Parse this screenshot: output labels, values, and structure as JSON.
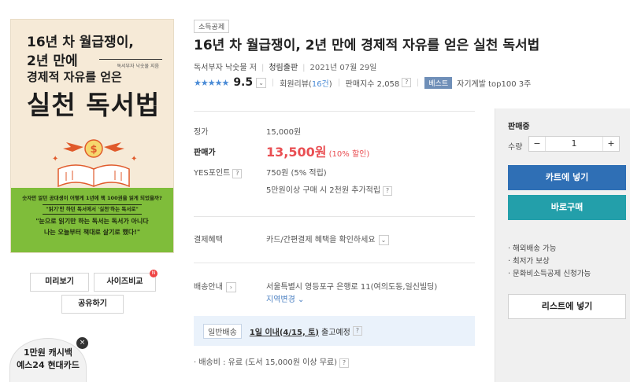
{
  "cover": {
    "line1": "16년 차 월급쟁이,",
    "line2": "2년 만에",
    "line3": "경제적 자유를 얻은",
    "line4": "실천 독서법",
    "byline": "독서부자 낙숫물 지음",
    "band_line1": "숫자만 알던 공대생이 어떻게 1년에 책 100권을 읽게 되었을까?",
    "band_line2": "\"읽기'만 하던 독서에서 '실천'하는 독서로\"",
    "band_line3": "\"눈으로 읽기만 하는 독서는 독서가 아니다",
    "band_line4": "나는 오늘부터 책대로 살기로 했다!\""
  },
  "left_buttons": {
    "preview": "미리보기",
    "size_compare": "사이즈비교",
    "share": "공유하기",
    "badge": "N"
  },
  "promo": {
    "line1": "1만원 캐시백",
    "line2": "예스24 현대카드",
    "close": "×"
  },
  "product": {
    "category_tag": "소득공제",
    "title": "16년 차 월급쟁이, 2년 만에 경제적 자유를 얻은 실천 독서법",
    "author": "독서부자 낙숫물 저",
    "publisher": "청림출판",
    "date": "2021년 07월 29일"
  },
  "rating": {
    "stars": "★★★★★",
    "score": "9.5",
    "dropdown": "⌄",
    "review_label": "회원리뷰(",
    "review_count": "16건",
    "review_close": ")",
    "sales_label": "판매지수 2,058",
    "help": "?",
    "best_tag": "베스트",
    "best_text": "자기계발 top100 3주"
  },
  "price": {
    "list_label": "정가",
    "list_value": "15,000원",
    "sale_label": "판매가",
    "sale_value": "13,500원",
    "discount": "(10% 할인)",
    "points_label": "YES포인트",
    "points_help": "?",
    "points_value": "750원 (5% 적립)",
    "extra_points": "5만원이상 구매 시 2천원 추가적립",
    "extra_help": "?"
  },
  "payment": {
    "label": "결제혜택",
    "text": "카드/간편결제 혜택을 확인하세요",
    "toggle": "⌄"
  },
  "shipping": {
    "label": "배송안내",
    "arrow": "›",
    "address": "서울특별시 영등포구 은행로 11(여의도동,일신빌딩)",
    "change_region": "지역변경 ⌄",
    "type_tag": "일반배송",
    "eta_strong": "1일 이내(4/15, 토)",
    "eta_rest": "출고예정",
    "eta_help": "?",
    "fee": "· 배송비 : 유료 (도서 15,000원 이상 무료)",
    "fee_help": "?"
  },
  "panel": {
    "status": "판매중",
    "qty_label": "수량",
    "minus": "−",
    "qty_value": "1",
    "plus": "+",
    "cart_button": "카트에 넣기",
    "buy_button": "바로구매",
    "benefits": [
      "· 해외배송 가능",
      "· 최저가 보상",
      "· 문화비소득공제 신청가능"
    ],
    "list_button": "리스트에 넣기"
  }
}
